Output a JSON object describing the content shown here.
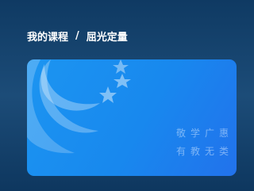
{
  "breadcrumb": {
    "parent": "我的课程",
    "separator": "/",
    "current": "屈光定量"
  },
  "card": {
    "motto_line1": "敬学广惠",
    "motto_line2": "有教无类",
    "logo_icon": "crescent-stars-logo-icon",
    "accent_color": "#1c8cf0"
  }
}
